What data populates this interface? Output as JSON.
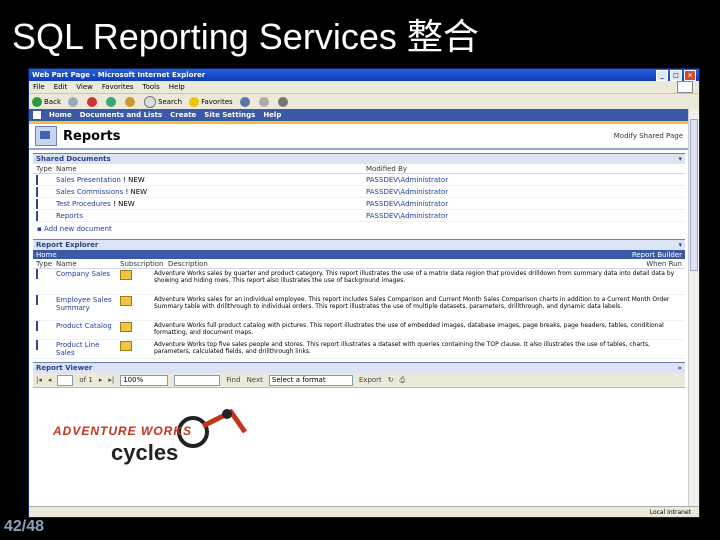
{
  "slide": {
    "title": "SQL Reporting Services 整合",
    "page_number": "42/48"
  },
  "window": {
    "title": "Web Part Page - Microsoft Internet Explorer"
  },
  "menu": [
    "File",
    "Edit",
    "View",
    "Favorites",
    "Tools",
    "Help"
  ],
  "toolbar": {
    "back": "Back",
    "search": "Search",
    "favorites": "Favorites"
  },
  "nav": [
    "Home",
    "Documents and Lists",
    "Create",
    "Site Settings",
    "Help"
  ],
  "page": {
    "title": "Reports",
    "view": "Modify Shared Page"
  },
  "shared_documents": {
    "title": "Shared Documents",
    "columns": [
      "Type",
      "Name",
      "Modified By"
    ],
    "rows": [
      {
        "name": "Sales Presentation",
        "badge": "! NEW",
        "modified_by": "PASSDEV\\Administrator",
        "icon": "document-icon"
      },
      {
        "name": "Sales Commissions",
        "badge": "! NEW",
        "modified_by": "PASSDEV\\Administrator",
        "icon": "spreadsheet-icon"
      },
      {
        "name": "Test Procedures",
        "badge": "! NEW",
        "modified_by": "PASSDEV\\Administrator",
        "icon": "document-icon"
      },
      {
        "name": "Reports",
        "badge": "",
        "modified_by": "PASSDEV\\Administrator",
        "icon": "document-icon"
      }
    ],
    "add_new": "Add new document"
  },
  "report_explorer": {
    "title": "Report Explorer",
    "builder": "Report Builder",
    "home": "Home",
    "columns": [
      "Type",
      "Name",
      "Subscription",
      "Description",
      "When Run"
    ],
    "rows": [
      {
        "name": "Company Sales",
        "description": "Adventure Works sales by quarter and product category. This report illustrates the use of a matrix data region that provides drilldown from summary data into detail data by showing and hiding rows. This report also illustrates the use of background images."
      },
      {
        "name": "Employee Sales Summary",
        "description": "Adventure Works sales for an individual employee. This report includes Sales Comparison and Current Month Sales Comparison charts in addition to a Current Month Order Summary table with drillthrough to individual orders. This report illustrates the use of multiple datasets, parameters, drillthrough, and dynamic data labels."
      },
      {
        "name": "Product Catalog",
        "description": "Adventure Works full product catalog with pictures. This report illustrates the use of embedded images, database images, page breaks, page headers, tables, conditional formatting, and document maps."
      },
      {
        "name": "Product Line Sales",
        "description": "Adventure Works top five sales people and stores. This report illustrates a dataset with queries containing the TOP clause. It also illustrates the use of tables, charts, parameters, calculated fields, and drillthrough links."
      }
    ]
  },
  "report_viewer": {
    "title": "Report Viewer",
    "page_of": "of 1",
    "zoom": "100%",
    "find": "Find",
    "next": "Next",
    "format": "Select a format",
    "export": "Export",
    "logo_top": "ADVENTURE WORKS",
    "logo_bottom": "cycles"
  },
  "status": {
    "zone": "Local intranet"
  }
}
